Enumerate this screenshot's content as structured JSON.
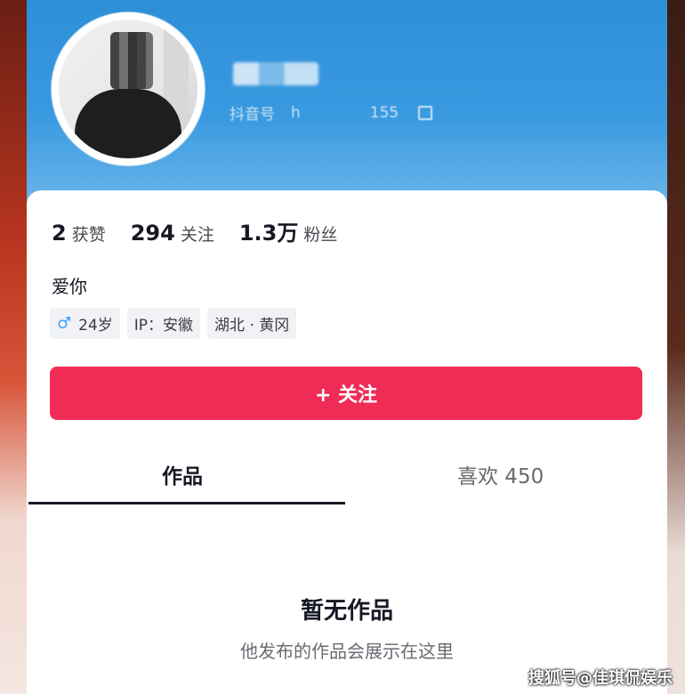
{
  "profile": {
    "douyin_id_label": "抖音号",
    "douyin_id_value": "h",
    "id_count": "155"
  },
  "stats": [
    {
      "num": "2",
      "label": "获赞"
    },
    {
      "num": "294",
      "label": "关注"
    },
    {
      "num": "1.3万",
      "label": "粉丝"
    }
  ],
  "bio": "爱你",
  "tags": {
    "gender_icon": "♂",
    "age": "24岁",
    "ip": "IP：安徽",
    "location": "湖北 · 黄冈"
  },
  "follow_button": {
    "label": "+ 关注"
  },
  "tabs": {
    "works": "作品",
    "likes": "喜欢 450"
  },
  "empty": {
    "title": "暂无作品",
    "subtitle": "他发布的作品会展示在这里"
  },
  "watermark": "搜狐号@佳琪侃娱乐",
  "colors": {
    "accent": "#f02c56",
    "header": "#3a9ae0"
  }
}
